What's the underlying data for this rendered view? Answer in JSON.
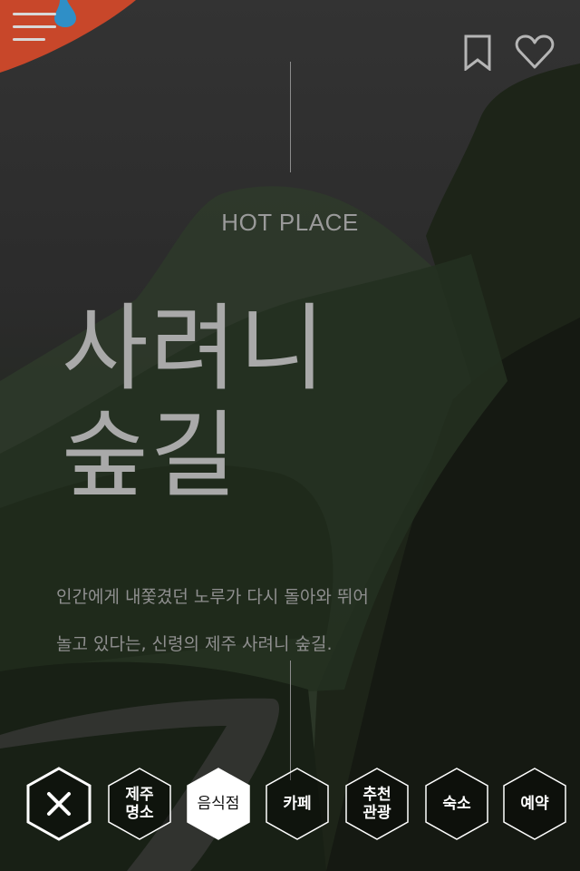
{
  "header": {
    "menu_icon": "hamburger-menu-icon",
    "bookmark_icon": "bookmark-icon",
    "like_icon": "heart-icon",
    "accent_color": "#c8472a",
    "drop_color": "#2f8fc7"
  },
  "hero": {
    "kicker": "HOT PLACE",
    "title_line1": "사려니",
    "title_line2": "숲길",
    "desc_line1": "인간에게 내쫓겼던 노루가 다시 돌아와 뛰어",
    "desc_line2": "놀고 있다는, 신령의  제주 사려니 숲길."
  },
  "nav": {
    "close_icon": "close-icon",
    "items": [
      {
        "line1": "제주",
        "line2": "명소",
        "active": false
      },
      {
        "line1": "음식점",
        "line2": "",
        "active": true
      },
      {
        "line1": "카페",
        "line2": "",
        "active": false
      },
      {
        "line1": "추천",
        "line2": "관광",
        "active": false
      },
      {
        "line1": "숙소",
        "line2": "",
        "active": false
      },
      {
        "line1": "예약",
        "line2": "",
        "active": false
      }
    ]
  }
}
